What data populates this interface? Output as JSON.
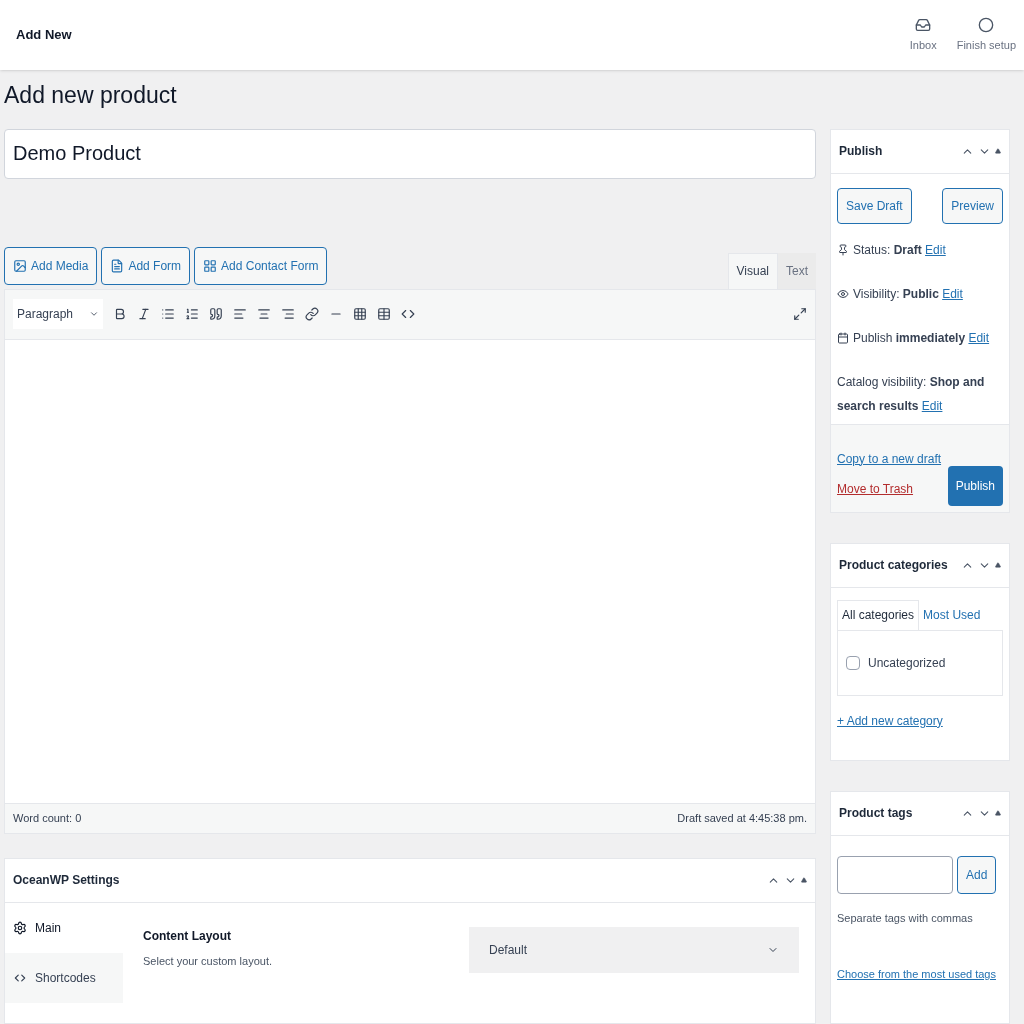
{
  "topbar": {
    "title": "Add New",
    "actions": [
      {
        "label": "Inbox",
        "kind": "inbox"
      },
      {
        "label": "Finish setup",
        "kind": "setup"
      }
    ]
  },
  "page_title": "Add new product",
  "product_name": {
    "value": "Demo Product"
  },
  "media_buttons": [
    {
      "label": "Add Media",
      "kind": "media"
    },
    {
      "label": "Add Form",
      "kind": "form"
    },
    {
      "label": "Add Contact Form",
      "kind": "contact"
    }
  ],
  "editor_tabs": [
    {
      "label": "Visual",
      "selected": true
    },
    {
      "label": "Text",
      "selected": false
    }
  ],
  "format_select": {
    "value": "Paragraph"
  },
  "toolbar": [
    {
      "kind": "bold"
    },
    {
      "kind": "italic"
    },
    {
      "kind": "bullets"
    },
    {
      "kind": "numbers"
    },
    {
      "kind": "quote"
    },
    {
      "kind": "align-left"
    },
    {
      "kind": "align-center"
    },
    {
      "kind": "align-right"
    },
    {
      "kind": "link"
    },
    {
      "kind": "more"
    },
    {
      "kind": "toolbar"
    },
    {
      "kind": "table"
    },
    {
      "kind": "shortcode"
    }
  ],
  "status_bar": {
    "word_count": "Word count: 0",
    "draft_saved": "Draft saved at 4:45:38 pm."
  },
  "oceanwp": {
    "title": "OceanWP Settings",
    "tabs": [
      {
        "label": "Main",
        "kind": "gear",
        "selected": true
      },
      {
        "label": "Shortcodes",
        "kind": "code",
        "selected": false
      }
    ],
    "field": {
      "label": "Content Layout",
      "description": "Select your custom layout.",
      "value": "Default"
    }
  },
  "publish": {
    "title": "Publish",
    "save_draft": "Save Draft",
    "preview": "Preview",
    "rows": [
      {
        "kind": "pin",
        "text": "Status: **Draft**",
        "link": "Edit"
      },
      {
        "kind": "eye",
        "text": "Visibility: **Public**",
        "link": "Edit"
      },
      {
        "kind": "calendar",
        "text": "Publish **immediately**",
        "link": "Edit"
      },
      {
        "kind": "none",
        "text": "Catalog visibility: **Shop and search results**",
        "link": "Edit"
      }
    ],
    "copy_link": "Copy to a new draft",
    "trash_link": "Move to Trash",
    "publish_button": "Publish"
  },
  "categories": {
    "title": "Product categories",
    "tabs": [
      {
        "label": "All categories",
        "selected": true
      },
      {
        "label": "Most Used",
        "selected": false
      }
    ],
    "items": [
      {
        "label": "Uncategorized",
        "checked": false
      }
    ],
    "add_link": "+ Add new category"
  },
  "tags": {
    "title": "Product tags",
    "add_button": "Add",
    "hint": "Separate tags with commas",
    "choose_link": "Choose from the most used tags"
  }
}
